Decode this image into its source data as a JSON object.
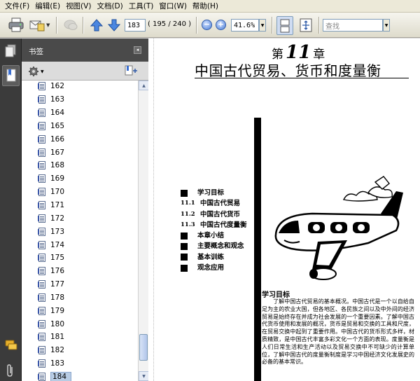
{
  "menu": [
    "文件(F)",
    "编辑(E)",
    "视图(V)",
    "文档(D)",
    "工具(T)",
    "窗口(W)",
    "帮助(H)"
  ],
  "toolbar": {
    "page_input": "183",
    "page_count": "( 195 / 240 )",
    "zoom_value": "41.6%",
    "search_placeholder": "查找"
  },
  "icons": {
    "print": "printer-icon",
    "mail": "email-icon",
    "page_up": "up-arrow-icon",
    "page_down": "down-arrow-icon"
  },
  "bookmarks": {
    "title": "书签",
    "items": [
      "162",
      "163",
      "164",
      "165",
      "166",
      "167",
      "168",
      "169",
      "170",
      "171",
      "172",
      "173",
      "174",
      "175",
      "176",
      "177",
      "178",
      "179",
      "180",
      "181",
      "182",
      "183",
      "184"
    ],
    "selected": "184"
  },
  "document": {
    "chapter_prefix": "第",
    "chapter_number": "11",
    "chapter_suffix": "章",
    "chapter_title": "中国古代贸易、货币和度量衡",
    "toc": [
      {
        "num": "",
        "text": "学习目标",
        "square": true
      },
      {
        "num": "11.1",
        "text": "中国古代贸易",
        "square": false
      },
      {
        "num": "11.2",
        "text": "中国古代货币",
        "square": false
      },
      {
        "num": "11.3",
        "text": "中国古代度量衡",
        "square": false
      },
      {
        "num": "",
        "text": "本章小结",
        "square": true
      },
      {
        "num": "",
        "text": "主要概念和观念",
        "square": true
      },
      {
        "num": "",
        "text": "基本训练",
        "square": true
      },
      {
        "num": "",
        "text": "观念应用",
        "square": true
      }
    ],
    "study_heading": "学习目标",
    "study_text": "了解中国古代贸易的基本概况。中国古代是一个以自给自足为主的农业大国，但各地区、各民族之间以及中外间的经济贸易是始终存在并成为社会发展的一个重要因素。了解中国古代货币使用和发展的概况，货币是贸易和交换的工具和尺度，在贸易交换中起到了重要作用。中国古代的货币形式多样，材质精致，是中国古代丰富多彩文化一个方面的表现。度量衡是人们日常生活和生产活动以及贸易交换中不可缺少的计算单位，了解中国古代的度量衡制度是学习中国经济文化发展史的必备的基本常识。"
  }
}
